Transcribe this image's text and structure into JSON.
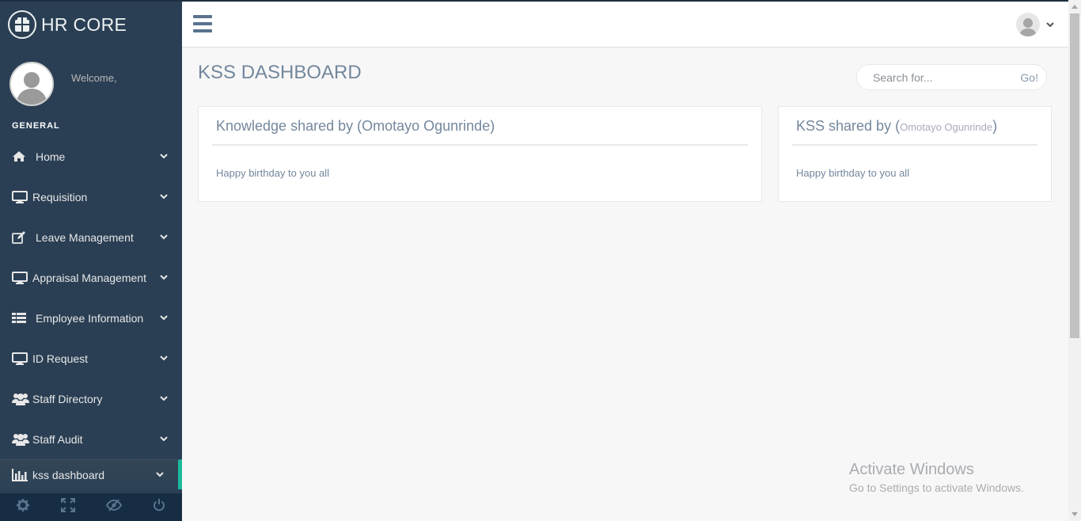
{
  "brand": {
    "title": "HR CORE",
    "logo_icon": "building-icon"
  },
  "profile": {
    "welcome": "Welcome,"
  },
  "sidebar": {
    "section_title": "GENERAL",
    "items": [
      {
        "label": "Home",
        "icon": "home-icon"
      },
      {
        "label": "Requisition",
        "icon": "desktop-icon"
      },
      {
        "label": "Leave Management",
        "icon": "edit-icon"
      },
      {
        "label": "Appraisal Management",
        "icon": "desktop-icon"
      },
      {
        "label": "Employee Information",
        "icon": "table-icon"
      },
      {
        "label": "ID Request",
        "icon": "desktop-icon"
      },
      {
        "label": "Staff Directory",
        "icon": "users-icon"
      },
      {
        "label": "Staff Audit",
        "icon": "users-icon"
      },
      {
        "label": "kss dashboard",
        "icon": "bar-chart-icon",
        "active": true
      }
    ],
    "footer_icons": [
      "settings-icon",
      "fullscreen-icon",
      "eye-slash-icon",
      "power-icon"
    ]
  },
  "main": {
    "page_title": "KSS DASHBOARD",
    "search": {
      "placeholder": "Search for...",
      "go_label": "Go!"
    },
    "panels": [
      {
        "title": "Knowledge shared by (Omotayo Ogunrinde)",
        "body": "Happy birthday to you all"
      },
      {
        "title_prefix": "KSS shared by (",
        "title_name": "Omotayo Ogunrinde",
        "title_suffix": ")",
        "body": "Happy birthday to you all"
      }
    ]
  },
  "watermark": {
    "title": "Activate Windows",
    "subtitle": "Go to Settings to activate Windows."
  },
  "colors": {
    "sidebar_bg": "#2A3F54",
    "accent": "#1ABB9C",
    "text_muted": "#73879C",
    "footer_bg": "#172D44"
  }
}
